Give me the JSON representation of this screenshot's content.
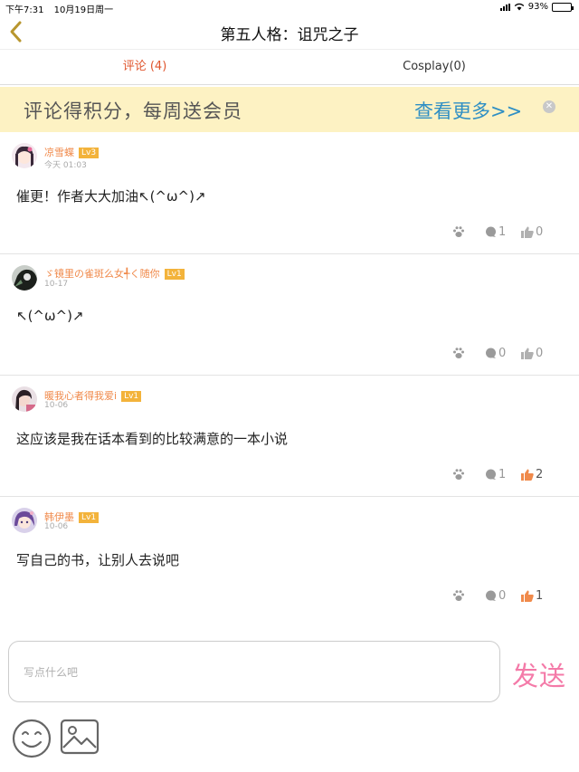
{
  "status_bar": {
    "time": "下午7:31",
    "date": "10月19日周一",
    "battery": "93%",
    "battery_level": 0.93
  },
  "nav": {
    "title": "第五人格：诅咒之子"
  },
  "tabs": [
    {
      "label": "评论 (4)"
    },
    {
      "label": "Cosplay(0)"
    }
  ],
  "banner": {
    "text": "评论得积分，每周送会员",
    "more": "查看更多>>"
  },
  "comments": [
    {
      "username": "凉雪蝶",
      "level": "Lv3",
      "date": "今天 01:03",
      "text": "催更！作者大大加油↖(^ω^)↗",
      "replies": "1",
      "likes": "0",
      "liked": false
    },
    {
      "username": "ゞ镜里の雀斑么女╃く随你",
      "level": "Lv1",
      "date": "10-17",
      "text": "↖(^ω^)↗",
      "replies": "0",
      "likes": "0",
      "liked": false
    },
    {
      "username": "暖我心者得我爱i",
      "level": "Lv1",
      "date": "10-06",
      "text": "这应该是我在话本看到的比较满意的一本小说",
      "replies": "1",
      "likes": "2",
      "liked": true
    },
    {
      "username": "韩伊墨",
      "level": "Lv1",
      "date": "10-06",
      "text": "写自己的书，让别人去说吧",
      "replies": "0",
      "likes": "1",
      "liked": true
    }
  ],
  "composer": {
    "placeholder": "写点什么吧",
    "send_label": "发送"
  },
  "icons": {
    "back": "chevron-left-icon",
    "paw": "paw-icon",
    "reply": "comment-bubble-icon",
    "like": "thumbs-up-icon",
    "emoji": "smiley-icon",
    "image": "image-icon",
    "close": "close-icon"
  },
  "colors": {
    "accent": "#e0562e",
    "username": "#f08a4b",
    "level_badge": "#f3b33b",
    "banner_bg": "#fdf2c3",
    "banner_link": "#2f8fc4",
    "send": "#f47aa8",
    "back": "#b8962e",
    "like_active": "#f08a4b"
  }
}
